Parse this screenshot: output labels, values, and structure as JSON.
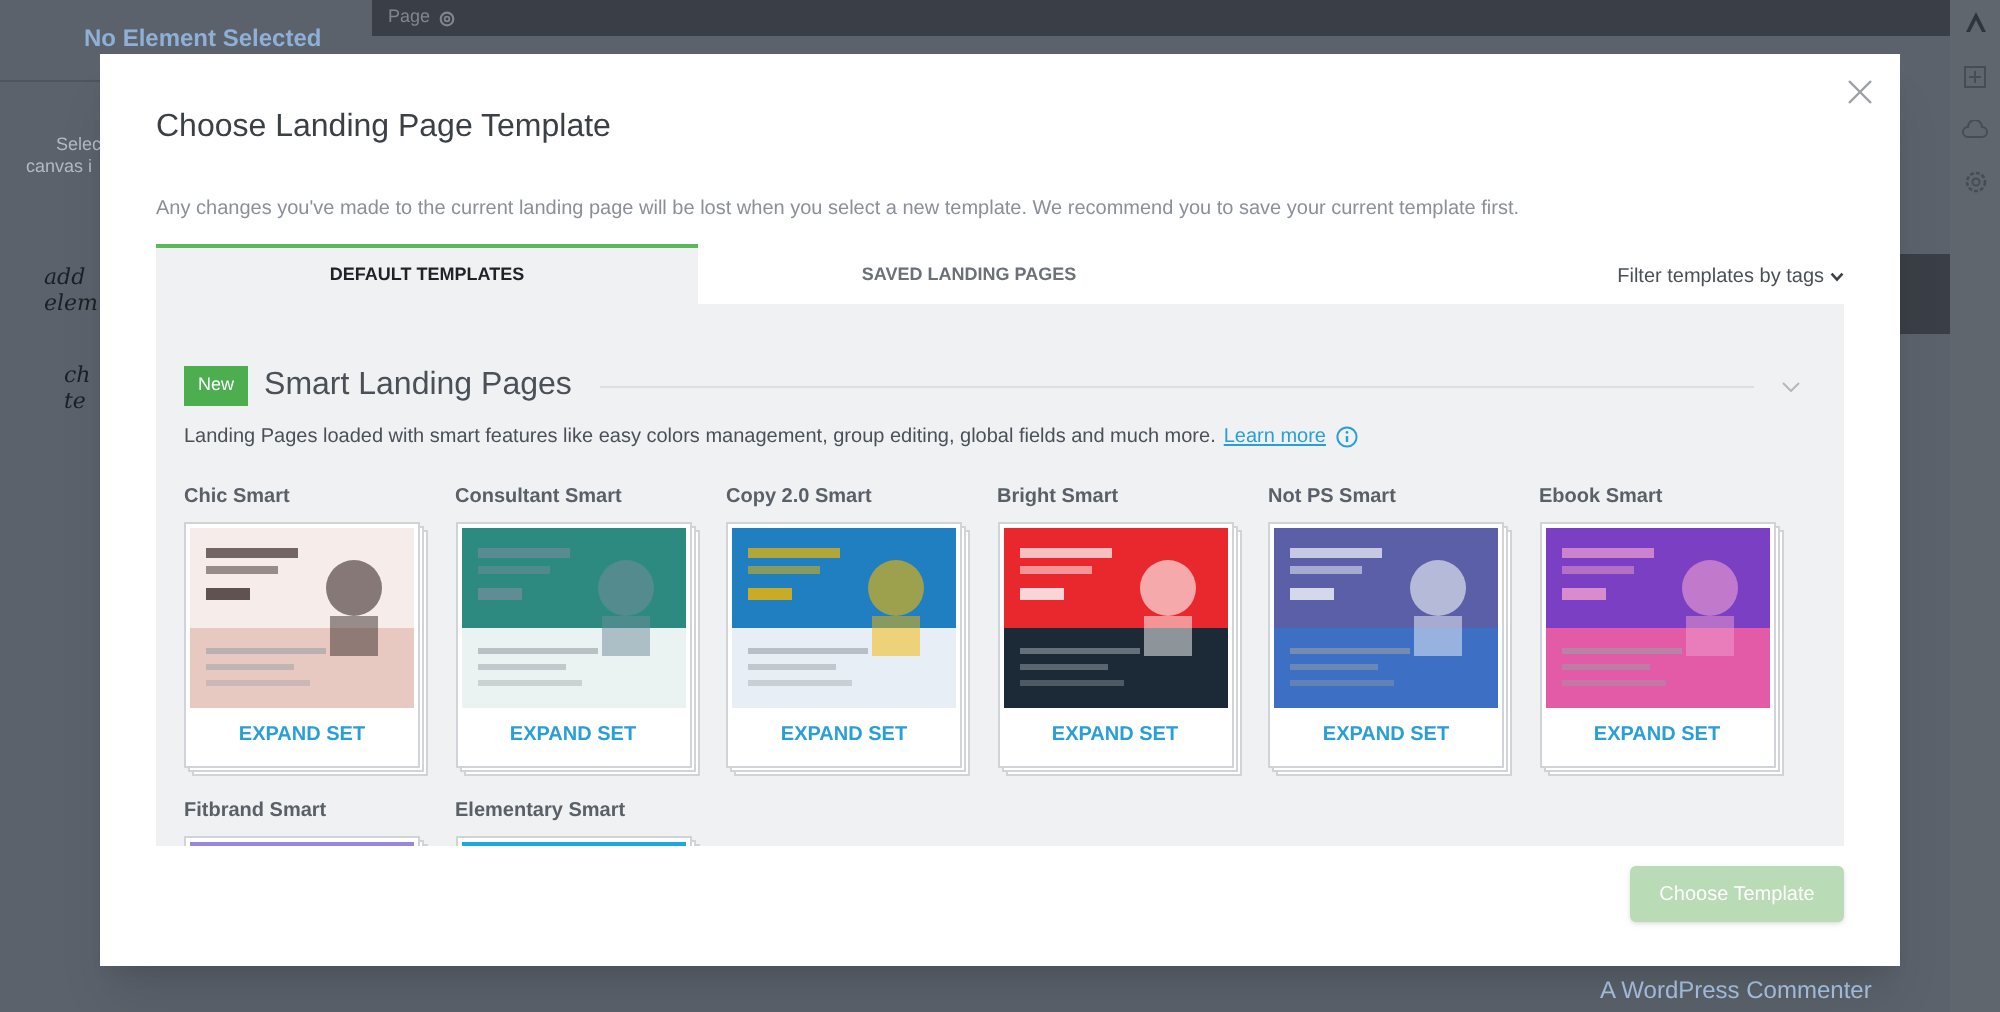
{
  "background": {
    "sidebar_title": "No Element Selected",
    "sidebar_hint_lines": [
      "Selec",
      "canvas i"
    ],
    "handwritten_lines": [
      "add",
      "elem",
      "ch",
      "te"
    ],
    "topbar_label": "Page",
    "comment_author": "A WordPress Commenter"
  },
  "modal": {
    "title": "Choose Landing Page Template",
    "description": "Any changes you've made to the current landing page will be lost when you select a new template. We recommend you to save your current template first.",
    "tabs": [
      {
        "label": "DEFAULT TEMPLATES",
        "selected": true
      },
      {
        "label": "SAVED LANDING PAGES",
        "selected": false
      }
    ],
    "filter": "Filter templates by tags",
    "section": {
      "badge": "New",
      "title": "Smart Landing Pages",
      "expanded": true,
      "description": "Landing Pages loaded with smart features like easy colors management, group editing, global fields and much more.",
      "link": "Learn more",
      "templates": [
        {
          "name": "Chic Smart",
          "action": "EXPAND SET"
        },
        {
          "name": "Consultant Smart",
          "action": "EXPAND SET"
        },
        {
          "name": "Copy 2.0 Smart",
          "action": "EXPAND SET"
        },
        {
          "name": "Bright Smart",
          "action": "EXPAND SET"
        },
        {
          "name": "Not PS Smart",
          "action": "EXPAND SET"
        },
        {
          "name": "Ebook Smart",
          "action": "EXPAND SET"
        },
        {
          "name": "Fitbrand Smart"
        },
        {
          "name": "Elementary Smart"
        }
      ]
    },
    "button": {
      "label": "Choose Template",
      "disabled": true
    }
  }
}
